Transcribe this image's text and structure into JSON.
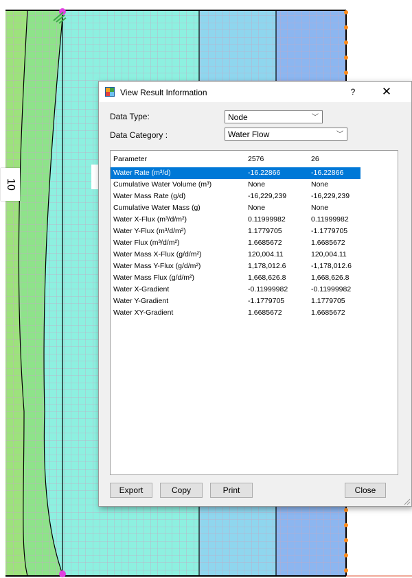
{
  "map": {
    "contour_label": "10"
  },
  "dialog": {
    "title": "View Result Information",
    "help_symbol": "?",
    "close_symbol": "✕",
    "data_type_label": "Data Type:",
    "data_type_value": "Node",
    "data_category_label": "Data Category :",
    "data_category_value": "Water Flow",
    "table": {
      "headers": [
        "Parameter",
        "2576",
        "26"
      ],
      "rows": [
        [
          "Water Rate (m³/d)",
          "-16.22866",
          "-16.22866"
        ],
        [
          "Cumulative Water Volume (m³)",
          "None",
          "None"
        ],
        [
          "Water Mass Rate (g/d)",
          "-16,229,239",
          "-16,229,239"
        ],
        [
          "Cumulative Water Mass (g)",
          "None",
          "None"
        ],
        [
          "Water X-Flux (m³/d/m²)",
          "0.11999982",
          "0.11999982"
        ],
        [
          "Water Y-Flux (m³/d/m²)",
          "1.1779705",
          "-1.1779705"
        ],
        [
          "Water Flux (m³/d/m²)",
          "1.6685672",
          "1.6685672"
        ],
        [
          "Water Mass X-Flux (g/d/m²)",
          "120,004.11",
          "120,004.11"
        ],
        [
          "Water Mass Y-Flux (g/d/m²)",
          "1,178,012.6",
          "-1,178,012.6"
        ],
        [
          "Water Mass Flux (g/d/m²)",
          "1,668,626.8",
          "1,668,626.8"
        ],
        [
          "Water X-Gradient",
          "-0.11999982",
          "-0.11999982"
        ],
        [
          "Water Y-Gradient",
          "-1.1779705",
          "1.1779705"
        ],
        [
          "Water XY-Gradient",
          "1.6685672",
          "1.6685672"
        ]
      ],
      "selected_row": 0
    },
    "buttons": {
      "export": "Export",
      "copy": "Copy",
      "print": "Print",
      "close": "Close"
    }
  },
  "colors": {
    "selection": "#0078d7",
    "dialog_bg": "#f0f0f0",
    "grid_line": "#c4a9c4",
    "contour": "#000000",
    "boundary_node": "#ff8c1a"
  }
}
